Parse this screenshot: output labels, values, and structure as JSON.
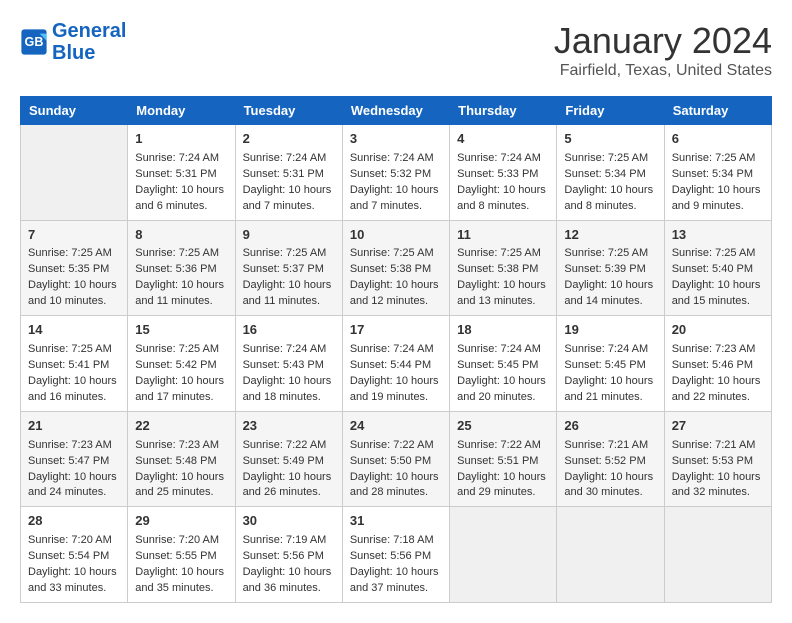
{
  "header": {
    "logo_line1": "General",
    "logo_line2": "Blue",
    "month_title": "January 2024",
    "location": "Fairfield, Texas, United States"
  },
  "columns": [
    "Sunday",
    "Monday",
    "Tuesday",
    "Wednesday",
    "Thursday",
    "Friday",
    "Saturday"
  ],
  "weeks": [
    [
      {
        "day": "",
        "info": ""
      },
      {
        "day": "1",
        "info": "Sunrise: 7:24 AM\nSunset: 5:31 PM\nDaylight: 10 hours\nand 6 minutes."
      },
      {
        "day": "2",
        "info": "Sunrise: 7:24 AM\nSunset: 5:31 PM\nDaylight: 10 hours\nand 7 minutes."
      },
      {
        "day": "3",
        "info": "Sunrise: 7:24 AM\nSunset: 5:32 PM\nDaylight: 10 hours\nand 7 minutes."
      },
      {
        "day": "4",
        "info": "Sunrise: 7:24 AM\nSunset: 5:33 PM\nDaylight: 10 hours\nand 8 minutes."
      },
      {
        "day": "5",
        "info": "Sunrise: 7:25 AM\nSunset: 5:34 PM\nDaylight: 10 hours\nand 8 minutes."
      },
      {
        "day": "6",
        "info": "Sunrise: 7:25 AM\nSunset: 5:34 PM\nDaylight: 10 hours\nand 9 minutes."
      }
    ],
    [
      {
        "day": "7",
        "info": "Sunrise: 7:25 AM\nSunset: 5:35 PM\nDaylight: 10 hours\nand 10 minutes."
      },
      {
        "day": "8",
        "info": "Sunrise: 7:25 AM\nSunset: 5:36 PM\nDaylight: 10 hours\nand 11 minutes."
      },
      {
        "day": "9",
        "info": "Sunrise: 7:25 AM\nSunset: 5:37 PM\nDaylight: 10 hours\nand 11 minutes."
      },
      {
        "day": "10",
        "info": "Sunrise: 7:25 AM\nSunset: 5:38 PM\nDaylight: 10 hours\nand 12 minutes."
      },
      {
        "day": "11",
        "info": "Sunrise: 7:25 AM\nSunset: 5:38 PM\nDaylight: 10 hours\nand 13 minutes."
      },
      {
        "day": "12",
        "info": "Sunrise: 7:25 AM\nSunset: 5:39 PM\nDaylight: 10 hours\nand 14 minutes."
      },
      {
        "day": "13",
        "info": "Sunrise: 7:25 AM\nSunset: 5:40 PM\nDaylight: 10 hours\nand 15 minutes."
      }
    ],
    [
      {
        "day": "14",
        "info": "Sunrise: 7:25 AM\nSunset: 5:41 PM\nDaylight: 10 hours\nand 16 minutes."
      },
      {
        "day": "15",
        "info": "Sunrise: 7:25 AM\nSunset: 5:42 PM\nDaylight: 10 hours\nand 17 minutes."
      },
      {
        "day": "16",
        "info": "Sunrise: 7:24 AM\nSunset: 5:43 PM\nDaylight: 10 hours\nand 18 minutes."
      },
      {
        "day": "17",
        "info": "Sunrise: 7:24 AM\nSunset: 5:44 PM\nDaylight: 10 hours\nand 19 minutes."
      },
      {
        "day": "18",
        "info": "Sunrise: 7:24 AM\nSunset: 5:45 PM\nDaylight: 10 hours\nand 20 minutes."
      },
      {
        "day": "19",
        "info": "Sunrise: 7:24 AM\nSunset: 5:45 PM\nDaylight: 10 hours\nand 21 minutes."
      },
      {
        "day": "20",
        "info": "Sunrise: 7:23 AM\nSunset: 5:46 PM\nDaylight: 10 hours\nand 22 minutes."
      }
    ],
    [
      {
        "day": "21",
        "info": "Sunrise: 7:23 AM\nSunset: 5:47 PM\nDaylight: 10 hours\nand 24 minutes."
      },
      {
        "day": "22",
        "info": "Sunrise: 7:23 AM\nSunset: 5:48 PM\nDaylight: 10 hours\nand 25 minutes."
      },
      {
        "day": "23",
        "info": "Sunrise: 7:22 AM\nSunset: 5:49 PM\nDaylight: 10 hours\nand 26 minutes."
      },
      {
        "day": "24",
        "info": "Sunrise: 7:22 AM\nSunset: 5:50 PM\nDaylight: 10 hours\nand 28 minutes."
      },
      {
        "day": "25",
        "info": "Sunrise: 7:22 AM\nSunset: 5:51 PM\nDaylight: 10 hours\nand 29 minutes."
      },
      {
        "day": "26",
        "info": "Sunrise: 7:21 AM\nSunset: 5:52 PM\nDaylight: 10 hours\nand 30 minutes."
      },
      {
        "day": "27",
        "info": "Sunrise: 7:21 AM\nSunset: 5:53 PM\nDaylight: 10 hours\nand 32 minutes."
      }
    ],
    [
      {
        "day": "28",
        "info": "Sunrise: 7:20 AM\nSunset: 5:54 PM\nDaylight: 10 hours\nand 33 minutes."
      },
      {
        "day": "29",
        "info": "Sunrise: 7:20 AM\nSunset: 5:55 PM\nDaylight: 10 hours\nand 35 minutes."
      },
      {
        "day": "30",
        "info": "Sunrise: 7:19 AM\nSunset: 5:56 PM\nDaylight: 10 hours\nand 36 minutes."
      },
      {
        "day": "31",
        "info": "Sunrise: 7:18 AM\nSunset: 5:56 PM\nDaylight: 10 hours\nand 37 minutes."
      },
      {
        "day": "",
        "info": ""
      },
      {
        "day": "",
        "info": ""
      },
      {
        "day": "",
        "info": ""
      }
    ]
  ]
}
